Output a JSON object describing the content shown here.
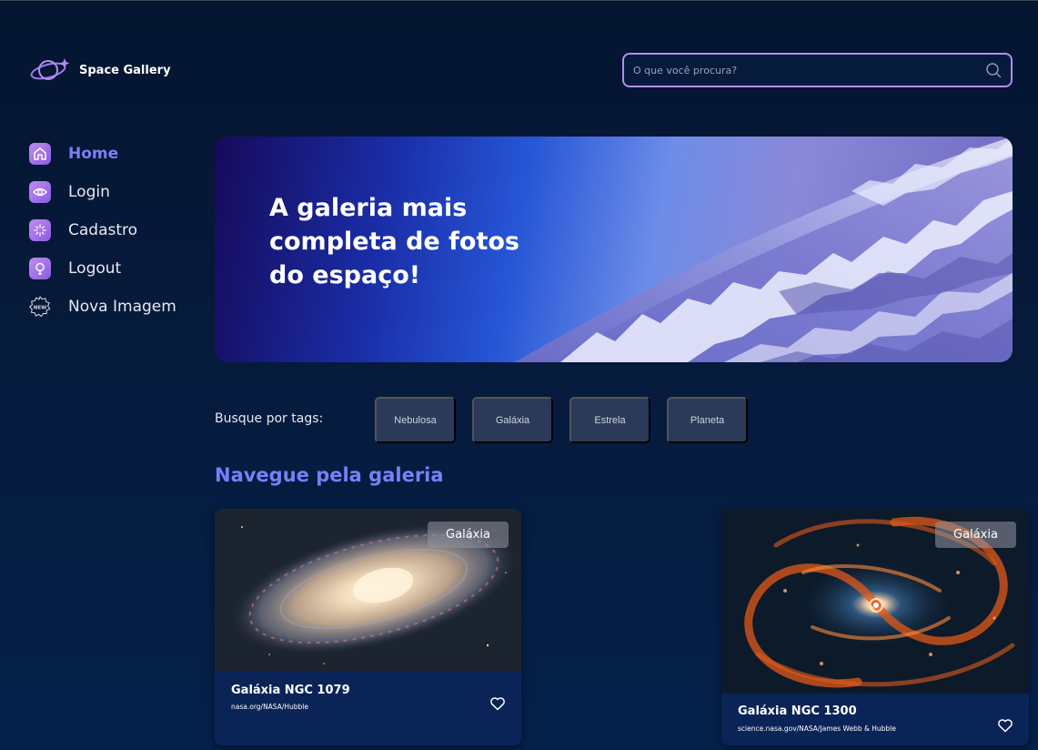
{
  "header": {
    "logo_text": "Space Gallery",
    "search_placeholder": "O que você procura?"
  },
  "sidebar": {
    "items": [
      {
        "label": "Home",
        "icon": "home-icon",
        "active": true
      },
      {
        "label": "Login",
        "icon": "eye-icon",
        "active": false
      },
      {
        "label": "Cadastro",
        "icon": "sparkle-icon",
        "active": false
      },
      {
        "label": "Logout",
        "icon": "lightbulb-icon",
        "active": false
      },
      {
        "label": "Nova Imagem",
        "icon": "new-badge-icon",
        "active": false
      }
    ]
  },
  "hero": {
    "title": "A galeria mais completa de fotos do espaço!"
  },
  "tags": {
    "label": "Busque por tags:",
    "items": [
      "Nebulosa",
      "Galáxia",
      "Estrela",
      "Planeta"
    ]
  },
  "gallery": {
    "title": "Navegue pela galeria",
    "cards": [
      {
        "badge": "Galáxia",
        "title": "Galáxia NGC 1079",
        "credit": "nasa.org/NASA/Hubble"
      },
      {
        "badge": "Galáxia",
        "title": "Galáxia NGC 1300",
        "credit": "science.nasa.gov/NASA/James Webb & Hubble"
      }
    ]
  },
  "colors": {
    "background": "#061a3b",
    "accent": "#7b7ef7",
    "icon_purple": "#a97cea",
    "tag_bg": "#2b3a58",
    "card_bg": "#0a2458"
  }
}
